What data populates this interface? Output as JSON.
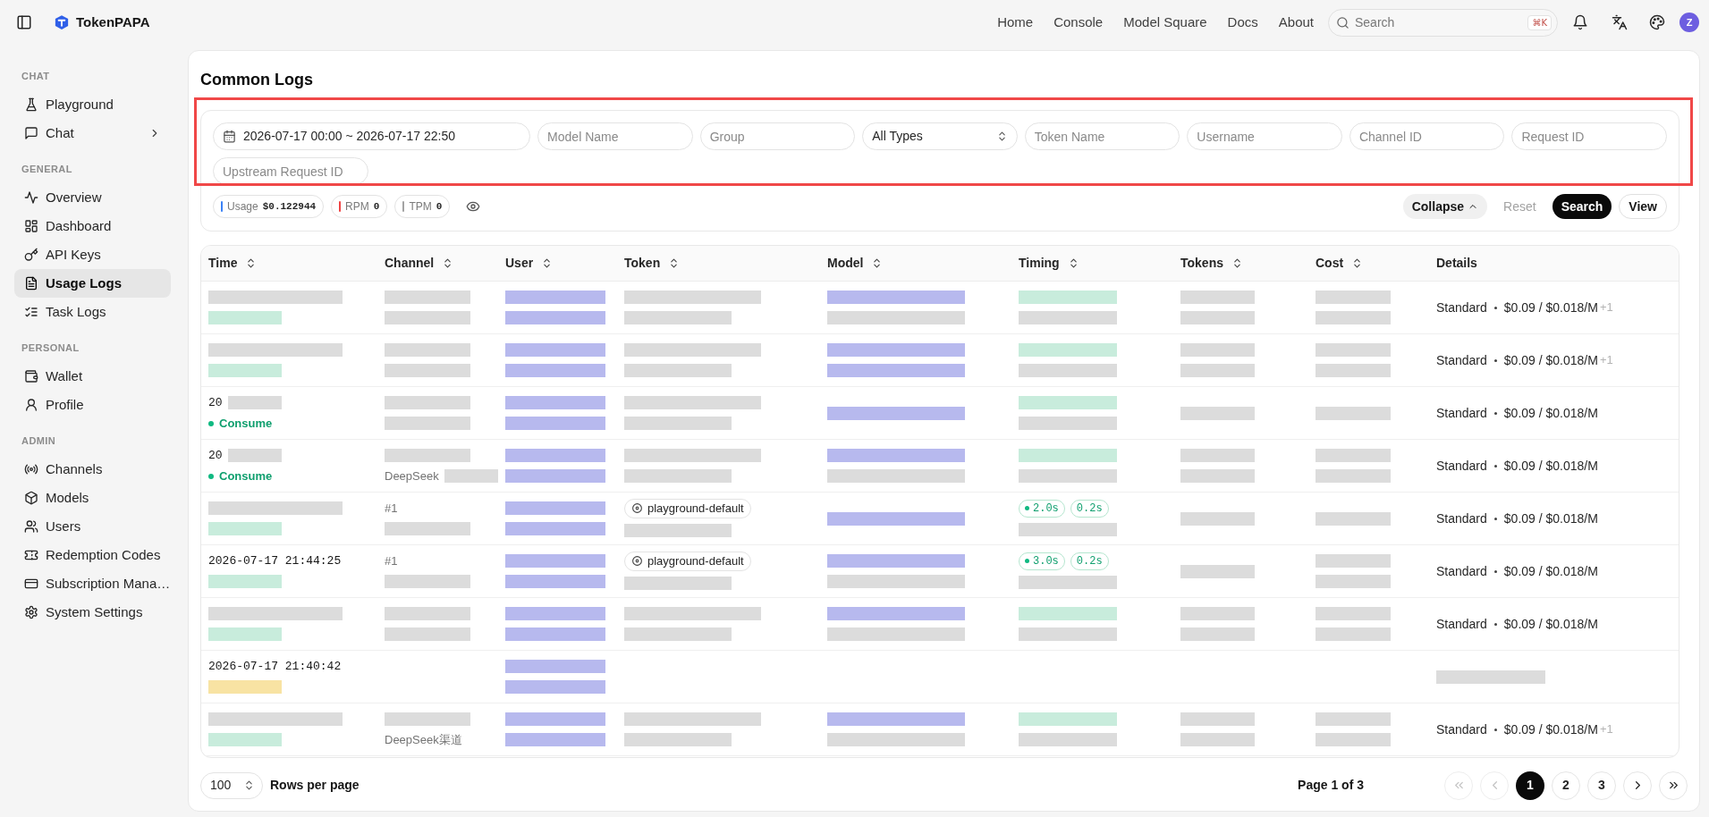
{
  "topbar": {
    "brand": "TokenPAPA",
    "nav": [
      {
        "label": "Home"
      },
      {
        "label": "Console"
      },
      {
        "label": "Model Square"
      },
      {
        "label": "Docs"
      },
      {
        "label": "About"
      }
    ],
    "search": {
      "placeholder": "Search",
      "shortcut": "⌘K"
    },
    "avatar": "Z"
  },
  "sidebar": {
    "sections": [
      {
        "label": "CHAT",
        "items": [
          {
            "label": "Playground",
            "selected": false
          },
          {
            "label": "Chat",
            "selected": false,
            "expanded": false
          }
        ]
      },
      {
        "label": "GENERAL",
        "items": [
          {
            "label": "Overview",
            "selected": false
          },
          {
            "label": "Dashboard",
            "selected": false
          },
          {
            "label": "API Keys",
            "selected": false
          },
          {
            "label": "Usage Logs",
            "selected": true
          },
          {
            "label": "Task Logs",
            "selected": false
          }
        ]
      },
      {
        "label": "PERSONAL",
        "items": [
          {
            "label": "Wallet",
            "selected": false
          },
          {
            "label": "Profile",
            "selected": false
          }
        ]
      },
      {
        "label": "ADMIN",
        "items": [
          {
            "label": "Channels",
            "selected": false
          },
          {
            "label": "Models",
            "selected": false
          },
          {
            "label": "Users",
            "selected": false
          },
          {
            "label": "Redemption Codes",
            "selected": false
          },
          {
            "label": "Subscription Mana…",
            "selected": false
          },
          {
            "label": "System Settings",
            "selected": false
          }
        ]
      }
    ]
  },
  "page": {
    "title": "Common Logs"
  },
  "filters": {
    "highlighted": true,
    "fields": [
      {
        "kind": "date",
        "value": "2026-07-17 00:00 ~ 2026-07-17 22:50"
      },
      {
        "kind": "input",
        "placeholder": "Model Name"
      },
      {
        "kind": "input",
        "placeholder": "Group"
      },
      {
        "kind": "select",
        "value": "All Types"
      },
      {
        "kind": "input",
        "placeholder": "Token Name"
      },
      {
        "kind": "input",
        "placeholder": "Username"
      },
      {
        "kind": "input",
        "placeholder": "Channel ID"
      },
      {
        "kind": "input",
        "placeholder": "Request ID"
      },
      {
        "kind": "input",
        "placeholder": "Upstream Request ID"
      }
    ],
    "stats": [
      {
        "label": "Usage",
        "value": "$0.122944",
        "color": "#3b82f6"
      },
      {
        "label": "RPM",
        "value": "0",
        "color": "#ef4444"
      },
      {
        "label": "TPM",
        "value": "0",
        "color": "#a3a3a3"
      }
    ],
    "actions": [
      {
        "kind": "collapse",
        "label": "Collapse",
        "expanded": true,
        "disabled": false
      },
      {
        "kind": "reset",
        "label": "Reset",
        "disabled": true
      },
      {
        "kind": "search",
        "label": "Search",
        "disabled": false
      },
      {
        "kind": "view",
        "label": "View",
        "disabled": false
      }
    ]
  },
  "table": {
    "columns": [
      {
        "label": "Time",
        "sortable": true
      },
      {
        "label": "Channel",
        "sortable": true
      },
      {
        "label": "User",
        "sortable": true
      },
      {
        "label": "Token",
        "sortable": true
      },
      {
        "label": "Model",
        "sortable": true
      },
      {
        "label": "Timing",
        "sortable": true
      },
      {
        "label": "Tokens",
        "sortable": true
      },
      {
        "label": "Cost",
        "sortable": true
      },
      {
        "label": "Details",
        "sortable": false
      }
    ],
    "rows": [
      {
        "time": [
          [
            {
              "kind": "redacted",
              "color": "#dcdcdc"
            }
          ],
          [
            {
              "kind": "redacted",
              "color": "#c8ecdc"
            }
          ]
        ],
        "channel": [
          [
            {
              "kind": "redacted",
              "color": "#dcdcdc"
            }
          ],
          [
            {
              "kind": "redacted",
              "color": "#dcdcdc"
            }
          ]
        ],
        "user": [
          [
            {
              "kind": "redacted",
              "color": "#b7b9ee"
            }
          ],
          [
            {
              "kind": "redacted",
              "color": "#b7b9ee"
            }
          ]
        ],
        "token": [
          [
            {
              "kind": "redacted",
              "color": "#dcdcdc"
            }
          ],
          [
            {
              "kind": "redacted",
              "color": "#dcdcdc"
            }
          ]
        ],
        "model": [
          [
            {
              "kind": "redacted",
              "color": "#b7b9ee"
            }
          ],
          [
            {
              "kind": "redacted",
              "color": "#dcdcdc"
            }
          ]
        ],
        "timing": [
          [
            {
              "kind": "redacted",
              "color": "#c8ecdc"
            }
          ],
          [
            {
              "kind": "redacted",
              "color": "#dcdcdc"
            }
          ]
        ],
        "tokens": [
          [
            {
              "kind": "redacted",
              "color": "#dcdcdc"
            }
          ],
          [
            {
              "kind": "redacted",
              "color": "#dcdcdc"
            }
          ]
        ],
        "cost": [
          [
            {
              "kind": "redacted",
              "color": "#dcdcdc"
            }
          ],
          [
            {
              "kind": "redacted",
              "color": "#dcdcdc"
            }
          ]
        ],
        "details": [
          [
            {
              "kind": "details",
              "tier": "Standard",
              "price": "$0.09 / $0.018/M",
              "extra": "+1"
            }
          ]
        ]
      },
      {
        "time": [
          [
            {
              "kind": "redacted",
              "color": "#dcdcdc"
            }
          ],
          [
            {
              "kind": "redacted",
              "color": "#c8ecdc"
            }
          ]
        ],
        "channel": [
          [
            {
              "kind": "redacted",
              "color": "#dcdcdc"
            }
          ],
          [
            {
              "kind": "redacted",
              "color": "#dcdcdc"
            }
          ]
        ],
        "user": [
          [
            {
              "kind": "redacted",
              "color": "#b7b9ee"
            }
          ],
          [
            {
              "kind": "redacted",
              "color": "#b7b9ee"
            }
          ]
        ],
        "token": [
          [
            {
              "kind": "redacted",
              "color": "#dcdcdc"
            }
          ],
          [
            {
              "kind": "redacted",
              "color": "#dcdcdc"
            }
          ]
        ],
        "model": [
          [
            {
              "kind": "redacted",
              "color": "#b7b9ee"
            }
          ],
          [
            {
              "kind": "redacted",
              "color": "#b7b9ee"
            }
          ]
        ],
        "timing": [
          [
            {
              "kind": "redacted",
              "color": "#c8ecdc"
            }
          ],
          [
            {
              "kind": "redacted",
              "color": "#dcdcdc"
            }
          ]
        ],
        "tokens": [
          [
            {
              "kind": "redacted",
              "color": "#dcdcdc"
            }
          ],
          [
            {
              "kind": "redacted",
              "color": "#dcdcdc"
            }
          ]
        ],
        "cost": [
          [
            {
              "kind": "redacted",
              "color": "#dcdcdc"
            }
          ],
          [
            {
              "kind": "redacted",
              "color": "#dcdcdc"
            }
          ]
        ],
        "details": [
          [
            {
              "kind": "details",
              "tier": "Standard",
              "price": "$0.09 / $0.018/M",
              "extra": "+1"
            }
          ]
        ]
      },
      {
        "time": [
          [
            {
              "kind": "timestamp",
              "text": "20"
            },
            {
              "kind": "redacted",
              "color": "#dcdcdc"
            }
          ],
          [
            {
              "kind": "status",
              "text": "Consume"
            }
          ]
        ],
        "channel": [
          [
            {
              "kind": "redacted",
              "color": "#dcdcdc"
            }
          ],
          [
            {
              "kind": "redacted",
              "color": "#dcdcdc"
            }
          ]
        ],
        "user": [
          [
            {
              "kind": "redacted",
              "color": "#b7b9ee"
            }
          ],
          [
            {
              "kind": "redacted",
              "color": "#b7b9ee"
            }
          ]
        ],
        "token": [
          [
            {
              "kind": "redacted",
              "color": "#dcdcdc"
            }
          ],
          [
            {
              "kind": "redacted",
              "color": "#dcdcdc"
            }
          ]
        ],
        "model": [
          [
            {
              "kind": "redacted",
              "color": "#b7b9ee"
            }
          ]
        ],
        "timing": [
          [
            {
              "kind": "redacted",
              "color": "#c8ecdc"
            }
          ],
          [
            {
              "kind": "redacted",
              "color": "#dcdcdc"
            }
          ]
        ],
        "tokens": [
          [
            {
              "kind": "redacted",
              "color": "#dcdcdc"
            }
          ]
        ],
        "cost": [
          [
            {
              "kind": "redacted",
              "color": "#dcdcdc"
            }
          ]
        ],
        "details": [
          [
            {
              "kind": "details",
              "tier": "Standard",
              "price": "$0.09 / $0.018/M"
            }
          ]
        ]
      },
      {
        "time": [
          [
            {
              "kind": "timestamp",
              "text": "20"
            },
            {
              "kind": "redacted",
              "color": "#dcdcdc"
            }
          ],
          [
            {
              "kind": "status",
              "text": "Consume"
            }
          ]
        ],
        "channel": [
          [
            {
              "kind": "redacted",
              "color": "#dcdcdc"
            }
          ],
          [
            {
              "kind": "text",
              "text": "DeepSeek"
            },
            {
              "kind": "redacted",
              "color": "#dcdcdc"
            }
          ]
        ],
        "user": [
          [
            {
              "kind": "redacted",
              "color": "#b7b9ee"
            }
          ],
          [
            {
              "kind": "redacted",
              "color": "#b7b9ee"
            }
          ]
        ],
        "token": [
          [
            {
              "kind": "redacted",
              "color": "#dcdcdc"
            }
          ],
          [
            {
              "kind": "redacted",
              "color": "#dcdcdc"
            }
          ]
        ],
        "model": [
          [
            {
              "kind": "redacted",
              "color": "#b7b9ee"
            }
          ],
          [
            {
              "kind": "redacted",
              "color": "#dcdcdc"
            }
          ]
        ],
        "timing": [
          [
            {
              "kind": "redacted",
              "color": "#c8ecdc"
            }
          ],
          [
            {
              "kind": "redacted",
              "color": "#dcdcdc"
            }
          ]
        ],
        "tokens": [
          [
            {
              "kind": "redacted",
              "color": "#dcdcdc"
            }
          ],
          [
            {
              "kind": "redacted",
              "color": "#dcdcdc"
            }
          ]
        ],
        "cost": [
          [
            {
              "kind": "redacted",
              "color": "#dcdcdc"
            }
          ],
          [
            {
              "kind": "redacted",
              "color": "#dcdcdc"
            }
          ]
        ],
        "details": [
          [
            {
              "kind": "details",
              "tier": "Standard",
              "price": "$0.09 / $0.018/M"
            }
          ]
        ]
      },
      {
        "time": [
          [
            {
              "kind": "redacted",
              "color": "#dcdcdc"
            }
          ],
          [
            {
              "kind": "redacted",
              "color": "#c8ecdc"
            }
          ]
        ],
        "channel": [
          [
            {
              "kind": "text",
              "text": "#1"
            }
          ],
          [
            {
              "kind": "redacted",
              "color": "#dcdcdc"
            }
          ]
        ],
        "user": [
          [
            {
              "kind": "redacted",
              "color": "#b7b9ee"
            }
          ],
          [
            {
              "kind": "redacted",
              "color": "#b7b9ee"
            }
          ]
        ],
        "token": [
          [
            {
              "kind": "token",
              "text": "playground-default"
            }
          ],
          [
            {
              "kind": "redacted",
              "color": "#dcdcdc"
            }
          ]
        ],
        "model": [
          [
            {
              "kind": "redacted",
              "color": "#b7b9ee"
            }
          ]
        ],
        "timing": [
          [
            {
              "kind": "timing",
              "text": "2.0s",
              "dot": true
            },
            {
              "kind": "timing",
              "text": "0.2s",
              "dot": false
            }
          ],
          [
            {
              "kind": "redacted",
              "color": "#dcdcdc"
            }
          ]
        ],
        "tokens": [
          [
            {
              "kind": "redacted",
              "color": "#dcdcdc"
            }
          ]
        ],
        "cost": [
          [
            {
              "kind": "redacted",
              "color": "#dcdcdc"
            }
          ]
        ],
        "details": [
          [
            {
              "kind": "details",
              "tier": "Standard",
              "price": "$0.09 / $0.018/M"
            }
          ]
        ]
      },
      {
        "time": [
          [
            {
              "kind": "timestamp",
              "text": "2026-07-17 21:44:25"
            }
          ],
          [
            {
              "kind": "redacted",
              "color": "#c8ecdc"
            }
          ]
        ],
        "channel": [
          [
            {
              "kind": "text",
              "text": "#1"
            }
          ],
          [
            {
              "kind": "redacted",
              "color": "#dcdcdc"
            }
          ]
        ],
        "user": [
          [
            {
              "kind": "redacted",
              "color": "#b7b9ee"
            }
          ],
          [
            {
              "kind": "redacted",
              "color": "#b7b9ee"
            }
          ]
        ],
        "token": [
          [
            {
              "kind": "token",
              "text": "playground-default"
            }
          ],
          [
            {
              "kind": "redacted",
              "color": "#dcdcdc"
            }
          ]
        ],
        "model": [
          [
            {
              "kind": "redacted",
              "color": "#b7b9ee"
            }
          ],
          [
            {
              "kind": "redacted",
              "color": "#dcdcdc"
            }
          ]
        ],
        "timing": [
          [
            {
              "kind": "timing",
              "text": "3.0s",
              "dot": true
            },
            {
              "kind": "timing",
              "text": "0.2s",
              "dot": false
            }
          ],
          [
            {
              "kind": "redacted",
              "color": "#dcdcdc"
            }
          ]
        ],
        "tokens": [
          [
            {
              "kind": "redacted",
              "color": "#dcdcdc"
            }
          ]
        ],
        "cost": [
          [
            {
              "kind": "redacted",
              "color": "#dcdcdc"
            }
          ],
          [
            {
              "kind": "redacted",
              "color": "#dcdcdc"
            }
          ]
        ],
        "details": [
          [
            {
              "kind": "details",
              "tier": "Standard",
              "price": "$0.09 / $0.018/M"
            }
          ]
        ]
      },
      {
        "time": [
          [
            {
              "kind": "redacted",
              "color": "#dcdcdc"
            }
          ],
          [
            {
              "kind": "redacted",
              "color": "#c8ecdc"
            }
          ]
        ],
        "channel": [
          [
            {
              "kind": "redacted",
              "color": "#dcdcdc"
            }
          ],
          [
            {
              "kind": "redacted",
              "color": "#dcdcdc"
            }
          ]
        ],
        "user": [
          [
            {
              "kind": "redacted",
              "color": "#b7b9ee"
            }
          ],
          [
            {
              "kind": "redacted",
              "color": "#b7b9ee"
            }
          ]
        ],
        "token": [
          [
            {
              "kind": "redacted",
              "color": "#dcdcdc"
            }
          ],
          [
            {
              "kind": "redacted",
              "color": "#dcdcdc"
            }
          ]
        ],
        "model": [
          [
            {
              "kind": "redacted",
              "color": "#b7b9ee"
            }
          ],
          [
            {
              "kind": "redacted",
              "color": "#dcdcdc"
            }
          ]
        ],
        "timing": [
          [
            {
              "kind": "redacted",
              "color": "#c8ecdc"
            }
          ],
          [
            {
              "kind": "redacted",
              "color": "#dcdcdc"
            }
          ]
        ],
        "tokens": [
          [
            {
              "kind": "redacted",
              "color": "#dcdcdc"
            }
          ],
          [
            {
              "kind": "redacted",
              "color": "#dcdcdc"
            }
          ]
        ],
        "cost": [
          [
            {
              "kind": "redacted",
              "color": "#dcdcdc"
            }
          ],
          [
            {
              "kind": "redacted",
              "color": "#dcdcdc"
            }
          ]
        ],
        "details": [
          [
            {
              "kind": "details",
              "tier": "Standard",
              "price": "$0.09 / $0.018/M"
            }
          ]
        ]
      },
      {
        "time": [
          [
            {
              "kind": "timestamp",
              "text": "2026-07-17 21:40:42"
            }
          ],
          [
            {
              "kind": "redacted",
              "color": "#f8e3a3"
            }
          ]
        ],
        "user": [
          [
            {
              "kind": "redacted",
              "color": "#b7b9ee"
            }
          ],
          [
            {
              "kind": "redacted",
              "color": "#b7b9ee"
            }
          ]
        ],
        "details": [
          [
            {
              "kind": "redacted",
              "color": "#dcdcdc"
            }
          ]
        ]
      },
      {
        "time": [
          [
            {
              "kind": "redacted",
              "color": "#dcdcdc"
            }
          ],
          [
            {
              "kind": "redacted",
              "color": "#c8ecdc"
            }
          ]
        ],
        "channel": [
          [
            {
              "kind": "redacted",
              "color": "#dcdcdc"
            }
          ],
          [
            {
              "kind": "text",
              "text": "DeepSeek渠道"
            }
          ]
        ],
        "user": [
          [
            {
              "kind": "redacted",
              "color": "#b7b9ee"
            }
          ],
          [
            {
              "kind": "redacted",
              "color": "#b7b9ee"
            }
          ]
        ],
        "token": [
          [
            {
              "kind": "redacted",
              "color": "#dcdcdc"
            }
          ],
          [
            {
              "kind": "redacted",
              "color": "#dcdcdc"
            }
          ]
        ],
        "model": [
          [
            {
              "kind": "redacted",
              "color": "#b7b9ee"
            }
          ],
          [
            {
              "kind": "redacted",
              "color": "#dcdcdc"
            }
          ]
        ],
        "timing": [
          [
            {
              "kind": "redacted",
              "color": "#c8ecdc"
            }
          ],
          [
            {
              "kind": "redacted",
              "color": "#dcdcdc"
            }
          ]
        ],
        "tokens": [
          [
            {
              "kind": "redacted",
              "color": "#dcdcdc"
            }
          ],
          [
            {
              "kind": "redacted",
              "color": "#dcdcdc"
            }
          ]
        ],
        "cost": [
          [
            {
              "kind": "redacted",
              "color": "#dcdcdc"
            }
          ],
          [
            {
              "kind": "redacted",
              "color": "#dcdcdc"
            }
          ]
        ],
        "details": [
          [
            {
              "kind": "details",
              "tier": "Standard",
              "price": "$0.09 / $0.018/M",
              "extra": "+1"
            }
          ]
        ]
      }
    ]
  },
  "pagination": {
    "page_size": "100",
    "page_size_label": "Rows per page",
    "page_info": "Page 1 of 3",
    "controls": [
      {
        "kind": "first",
        "disabled": true
      },
      {
        "kind": "prev",
        "disabled": true
      },
      {
        "kind": "next",
        "disabled": false
      },
      {
        "kind": "last",
        "disabled": false
      }
    ],
    "pages": [
      {
        "label": "1",
        "selected": true
      },
      {
        "label": "2",
        "selected": false
      },
      {
        "label": "3",
        "selected": false
      }
    ]
  }
}
